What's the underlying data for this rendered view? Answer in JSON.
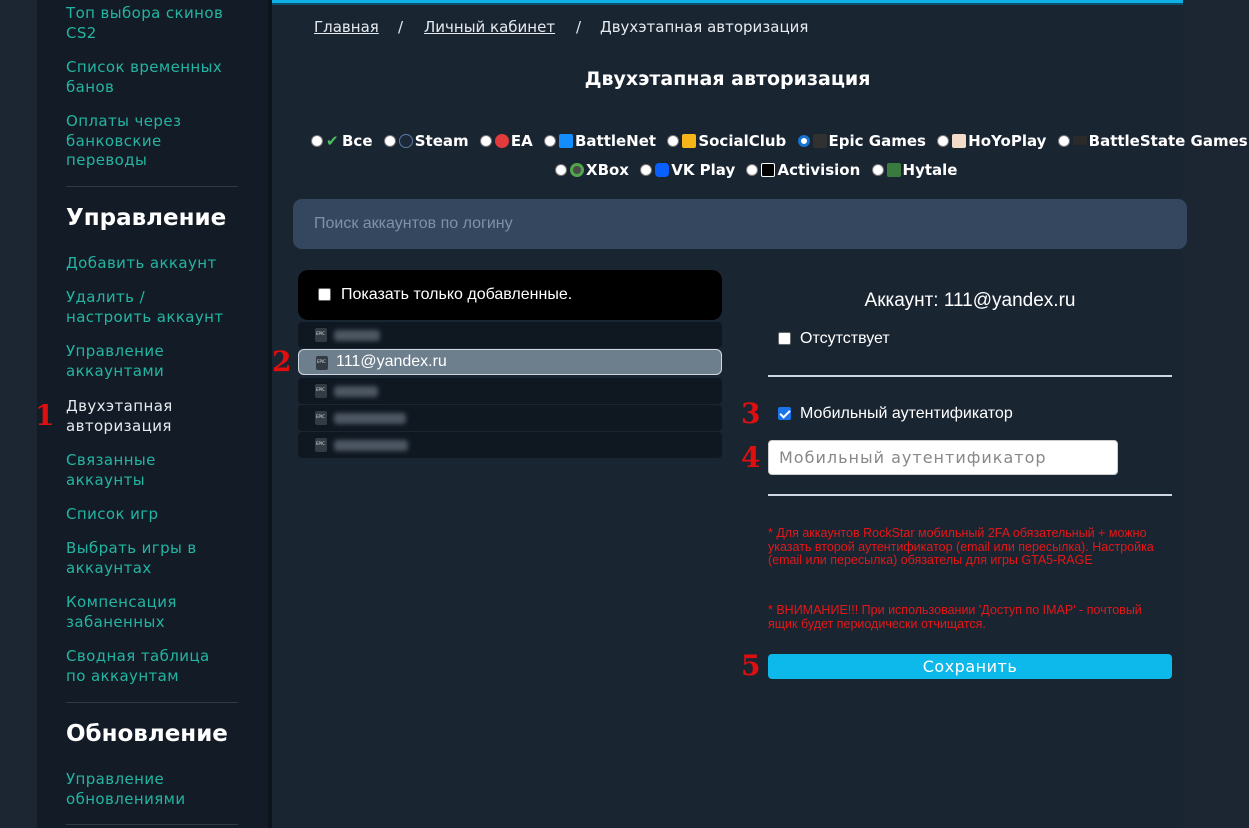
{
  "sidebar": {
    "links_top": [
      "Топ выбора скинов\nCS2",
      "Список временных\nбанов",
      "Оплаты через\nбанковские\nпереводы"
    ],
    "section_manage": "Управление",
    "manage_items": [
      "Добавить аккаунт",
      "Удалить /\nнастроить аккаунт",
      "Управление\nаккаунтами",
      "Двухэтапная\nавторизация",
      "Связанные\nаккаунты",
      "Список игр",
      "Выбрать игры в\nаккаунтах",
      "Компенсация\nзабаненных",
      "Сводная таблица\nпо аккаунтам"
    ],
    "section_update": "Обновление",
    "update_items": [
      "Управление\nобновлениями"
    ]
  },
  "annotations": [
    "1",
    "2",
    "3",
    "4",
    "5"
  ],
  "breadcrumb": {
    "home": "Главная",
    "sep": "/",
    "cabinet": "Личный кабинет",
    "current": "Двухэтапная авторизация"
  },
  "page_title": "Двухэтапная авторизация",
  "platforms": {
    "row1": [
      {
        "label": "Все",
        "icon": "check-icon",
        "selected": false
      },
      {
        "label": "Steam",
        "icon": "steam-icon",
        "selected": false
      },
      {
        "label": "EA",
        "icon": "ea-icon",
        "selected": false
      },
      {
        "label": "BattleNet",
        "icon": "battlenet-icon",
        "selected": false
      },
      {
        "label": "SocialClub",
        "icon": "rockstar-icon",
        "selected": false
      },
      {
        "label": "Epic Games",
        "icon": "epic-games-icon",
        "selected": true
      },
      {
        "label": "HoYoPlay",
        "icon": "hoyoplay-icon",
        "selected": false
      },
      {
        "label": "BattleState Games",
        "icon": "battlestate-icon",
        "selected": false
      }
    ],
    "row2": [
      {
        "label": "XBox",
        "icon": "xbox-icon",
        "selected": false
      },
      {
        "label": "VK Play",
        "icon": "vkplay-icon",
        "selected": false
      },
      {
        "label": "Activision",
        "icon": "activision-icon",
        "selected": false
      },
      {
        "label": "Hytale",
        "icon": "hytale-icon",
        "selected": false
      }
    ]
  },
  "search": {
    "placeholder": "Поиск аккаунтов по логину"
  },
  "account_list": {
    "filter_label": "Показать только добавленные.",
    "selected_label": "111@yandex.ru"
  },
  "details": {
    "account_line": "Аккаунт: 111@yandex.ru",
    "absent_label": "Отсутствует",
    "mobile_auth_label": "Мобильный аутентификатор",
    "mobile_auth_placeholder": "Мобильный аутентификатор",
    "warning1": "* Для аккаунтов RockStar мобильный 2FA обязательный + можно указать второй аутентификатор (email или пересылка). Настройка (email или пересылка) обязателы для игры GTA5-RAGE",
    "warning2": "* ВНИМАНИЕ!!! При использовании 'Доступ по IMAP' - почтовый ящик будет периодически отчищатся.",
    "save_label": "Сохранить"
  },
  "colors": {
    "accent": "#0db8ea",
    "sidebar_link": "#23b5a1",
    "warning": "#e51717",
    "annotation": "#e00f0f"
  }
}
